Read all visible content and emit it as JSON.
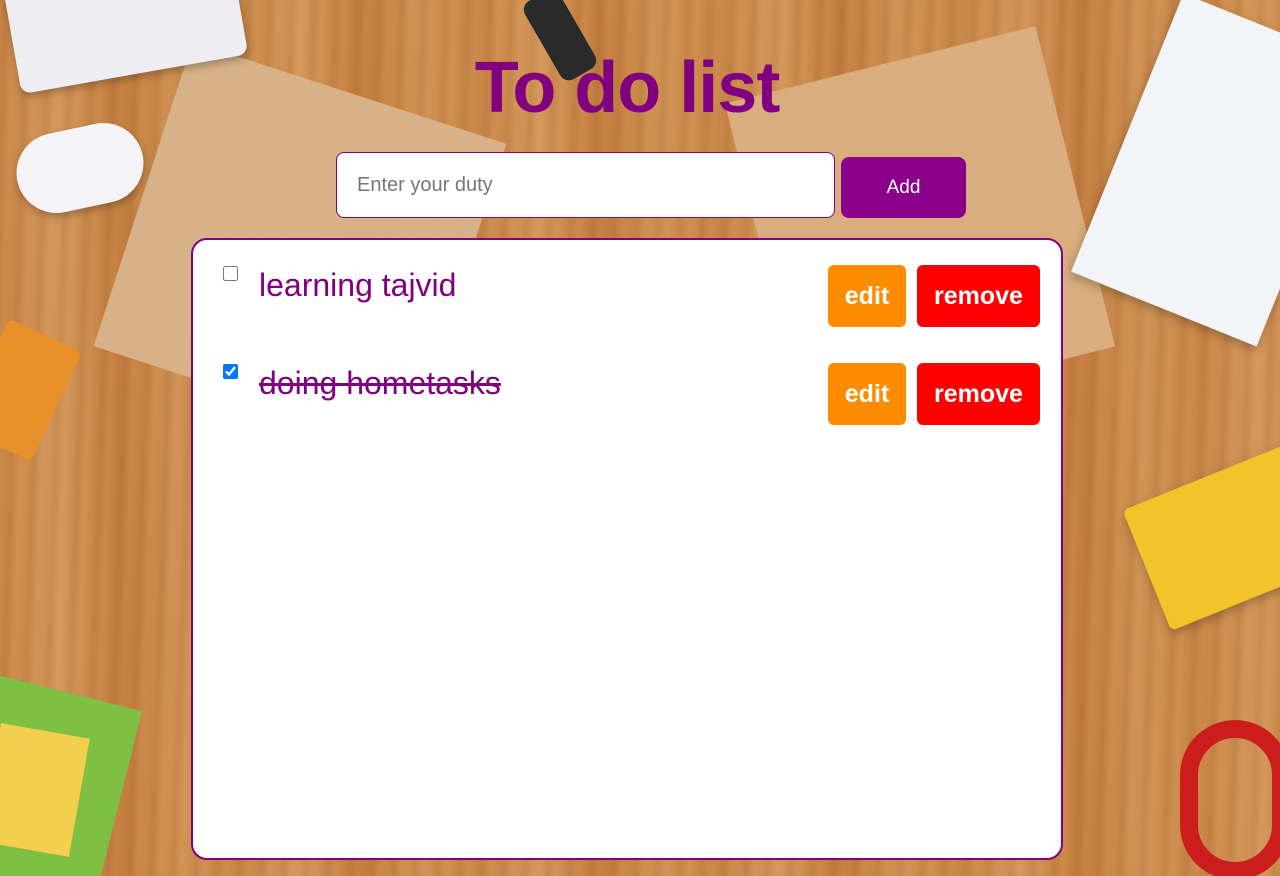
{
  "app": {
    "title": "To do list"
  },
  "input": {
    "value": "",
    "placeholder": "Enter your duty",
    "add_label": "Add"
  },
  "tasks": [
    {
      "text": "learning tajvid",
      "checked": false,
      "edit_label": "edit",
      "remove_label": "remove"
    },
    {
      "text": "doing hometasks",
      "checked": true,
      "edit_label": "edit",
      "remove_label": "remove"
    }
  ],
  "colors": {
    "accent": "#800080",
    "add_button": "#8b008b",
    "edit_button": "#ff8c00",
    "remove_button": "#ff0000",
    "panel_background": "#ffffff"
  }
}
